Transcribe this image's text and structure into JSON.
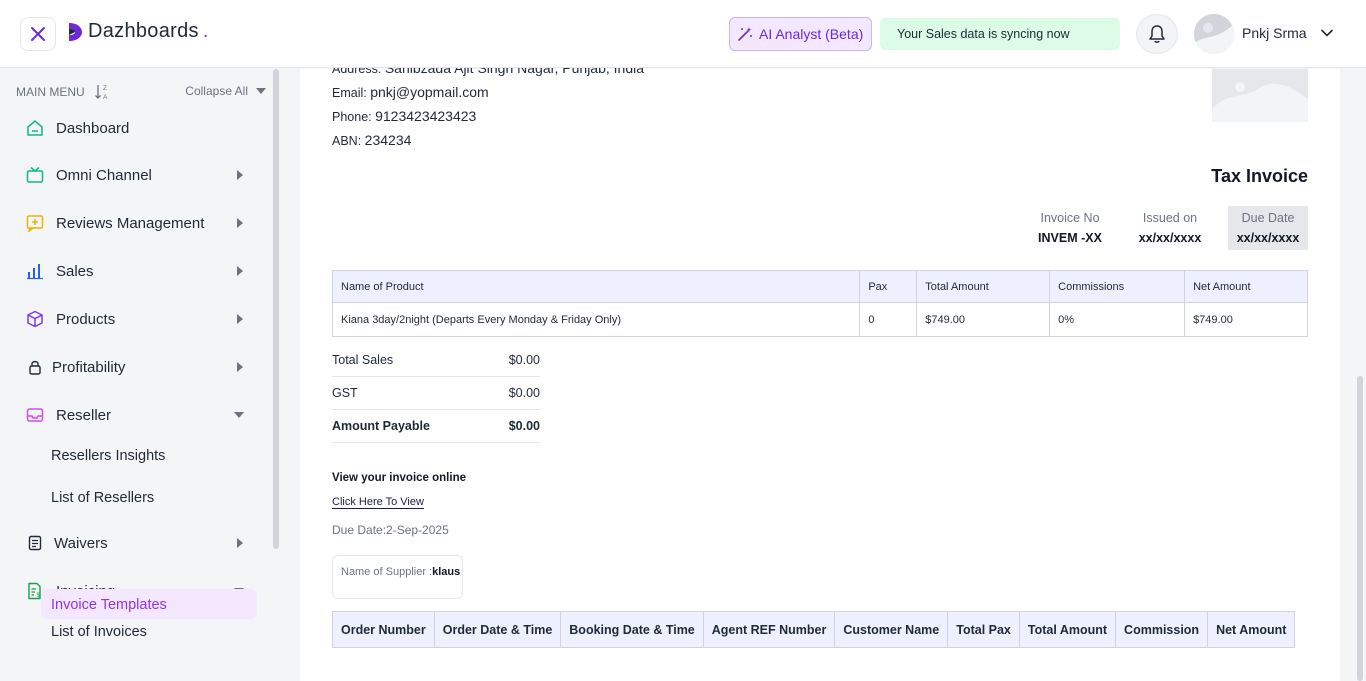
{
  "header": {
    "brand": "Dazhboards",
    "brand_dot": ".",
    "ai_button": "AI Analyst (Beta)",
    "sync_status": "Your Sales data is syncing now",
    "user_name": "Pnkj Srma"
  },
  "sidebar": {
    "menu_label": "MAIN MENU",
    "collapse_all": "Collapse All",
    "items": [
      {
        "label": "Dashboard",
        "icon": "home-icon"
      },
      {
        "label": "Omni Channel",
        "icon": "tv-icon"
      },
      {
        "label": "Reviews Management",
        "icon": "review-icon"
      },
      {
        "label": "Sales",
        "icon": "chart-icon"
      },
      {
        "label": "Products",
        "icon": "box-icon"
      },
      {
        "label": "Profitability",
        "icon": "lock-icon"
      },
      {
        "label": "Reseller",
        "icon": "inbox-icon"
      },
      {
        "label": "Waivers",
        "icon": "document-icon"
      },
      {
        "label": "Invoicing",
        "icon": "invoice-icon"
      }
    ],
    "reseller_sub": [
      "Resellers Insights",
      "List of Resellers"
    ],
    "invoicing_sub": [
      "List of Invoices",
      "Invoice Templates"
    ]
  },
  "invoice": {
    "address_label": "Address:",
    "address_value": "Sahibzada Ajit Singh Nagar, Punjab, India",
    "email_label": "Email:",
    "email_value": "pnkj@yopmail.com",
    "phone_label": "Phone:",
    "phone_value": "9123423423423",
    "abn_label": "ABN:",
    "abn_value": "234234",
    "title": "Tax Invoice",
    "meta": {
      "invoice_no_label": "Invoice No",
      "invoice_no": "INVEM -XX",
      "issued_label": "Issued on",
      "issued": "xx/xx/xxxx",
      "due_label": "Due Date",
      "due": "xx/xx/xxxx"
    },
    "product_headers": [
      "Name of Product",
      "Pax",
      "Total Amount",
      "Commissions",
      "Net Amount"
    ],
    "product_rows": [
      [
        "Kiana 3day/2night (Departs Every Monday & Friday Only)",
        "0",
        "$749.00",
        "0%",
        "$749.00"
      ]
    ],
    "totals": [
      {
        "label": "Total Sales",
        "value": "$0.00"
      },
      {
        "label": "GST",
        "value": "$0.00"
      },
      {
        "label": "Amount Payable",
        "value": "$0.00"
      }
    ],
    "view_online": "View your invoice online",
    "click_here": "Click Here To View",
    "due_prefix": "Due Date:",
    "due_date": "2-Sep-2025",
    "supplier_label": "Name of Supplier :",
    "supplier_name": "klaus",
    "order_headers": [
      "Order Number",
      "Order Date & Time",
      "Booking Date & Time",
      "Agent REF Number",
      "Customer Name",
      "Total Pax",
      "Total Amount",
      "Commission",
      "Net Amount"
    ]
  }
}
